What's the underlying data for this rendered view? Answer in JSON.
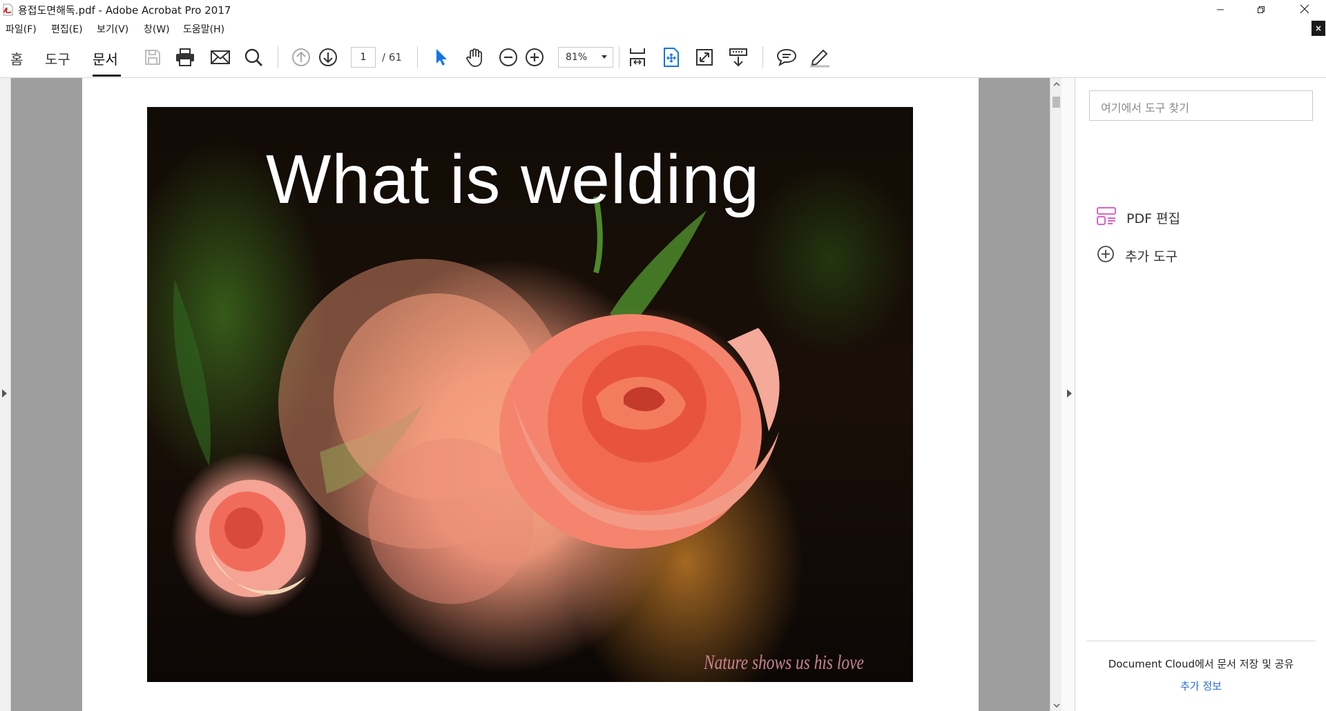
{
  "titlebar": {
    "title": "용접도면해독.pdf - Adobe Acrobat Pro 2017",
    "icons": [
      "pdf-file-icon",
      "minimize-icon",
      "restore-icon",
      "close-icon"
    ]
  },
  "menubar": {
    "items": [
      "파일(F)",
      "편집(E)",
      "보기(V)",
      "창(W)",
      "도움말(H)"
    ],
    "close_doc": "×"
  },
  "toolbar": {
    "tabs": [
      "홈",
      "도구",
      "문서"
    ],
    "active_tab": "문서",
    "page_current": "1",
    "page_total": "/ 61",
    "zoom": "81%",
    "icons": [
      "save-icon",
      "print-icon",
      "email-icon",
      "search-icon",
      "prev-page-icon",
      "next-page-icon",
      "select-cursor-icon",
      "hand-tool-icon",
      "zoom-out-icon",
      "zoom-in-icon",
      "scroll-mode-icon",
      "fit-page-icon",
      "full-screen-icon",
      "read-mode-icon",
      "comment-icon",
      "highlight-pen-icon"
    ],
    "accent_color": "#1473e6"
  },
  "slide": {
    "title": "What is welding",
    "caption": "Nature shows us his love"
  },
  "right_pane": {
    "search_placeholder": "여기에서 도구 찾기",
    "tools": [
      {
        "label": "PDF 편집",
        "icon": "edit-pdf-icon"
      },
      {
        "label": "추가 도구",
        "icon": "add-tool-icon"
      }
    ],
    "cloud_text": "Document Cloud에서 문서 저장 및 공유",
    "cloud_link": "추가 정보"
  }
}
